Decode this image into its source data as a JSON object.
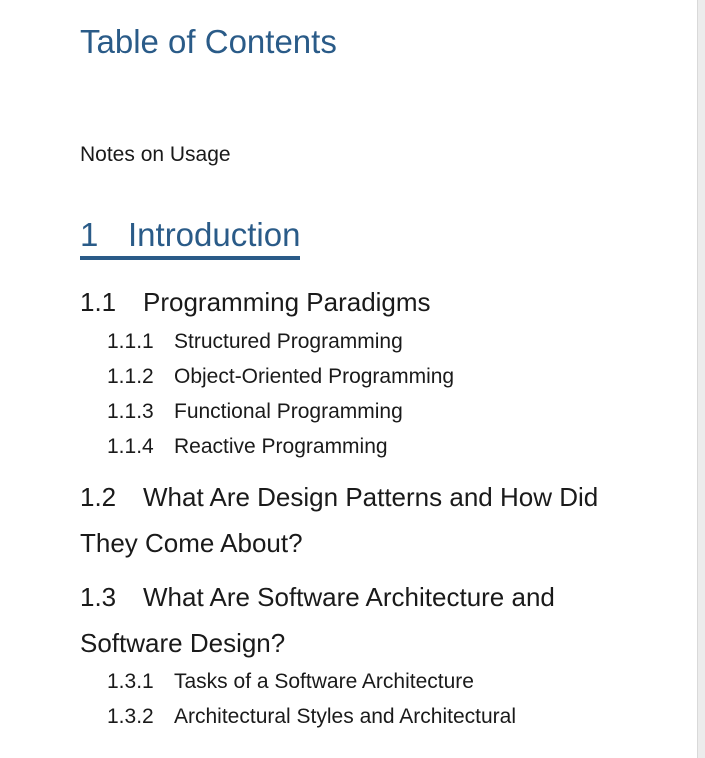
{
  "toc": {
    "title": "Table of Contents",
    "notes": "Notes on Usage",
    "chapter": {
      "num": "1",
      "label": "Introduction"
    },
    "sections": [
      {
        "num": "1.1",
        "label": "Programming Paradigms",
        "subsections": [
          {
            "num": "1.1.1",
            "label": "Structured Programming"
          },
          {
            "num": "1.1.2",
            "label": "Object-Oriented Programming"
          },
          {
            "num": "1.1.3",
            "label": "Functional Programming"
          },
          {
            "num": "1.1.4",
            "label": "Reactive Programming"
          }
        ]
      },
      {
        "num": "1.2",
        "label": "What Are Design Patterns and How Did They Come About?",
        "subsections": []
      },
      {
        "num": "1.3",
        "label": "What Are Software Architecture and Software Design?",
        "subsections": [
          {
            "num": "1.3.1",
            "label": "Tasks of a Software Architecture"
          },
          {
            "num": "1.3.2",
            "label": "Architectural Styles and Architectural"
          }
        ]
      }
    ]
  }
}
